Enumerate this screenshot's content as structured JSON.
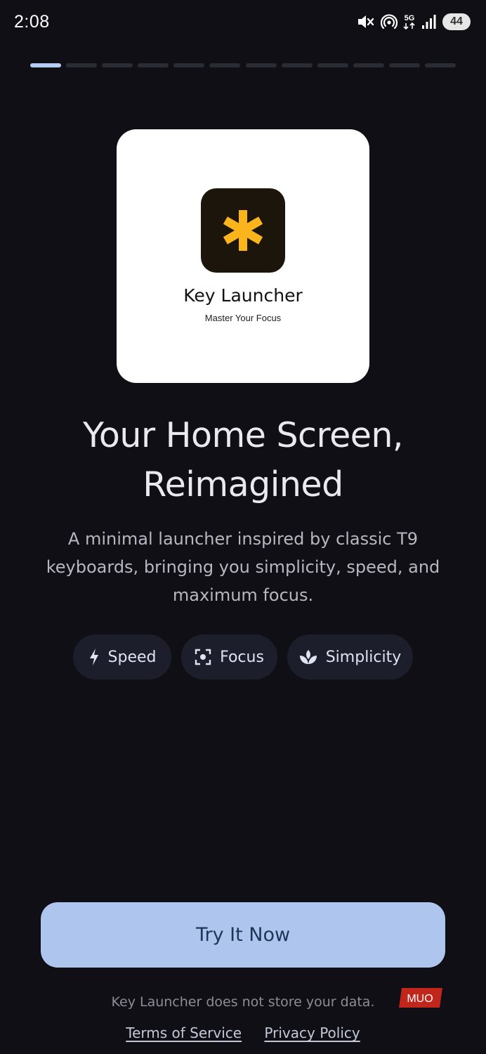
{
  "status_bar": {
    "time": "2:08",
    "network": "5G",
    "battery": "44",
    "icons": [
      "mute-icon",
      "hotspot-icon",
      "network-5g-icon",
      "signal-icon",
      "battery-icon"
    ]
  },
  "onboarding": {
    "total_steps": 12,
    "current_step": 1
  },
  "brand": {
    "name": "Key Launcher",
    "tagline": "Master Your Focus",
    "icon": "asterisk-icon",
    "icon_color": "#f9b51b",
    "icon_bg": "#1c150c"
  },
  "headline": {
    "line1": "Your Home Screen,",
    "line2": "Reimagined"
  },
  "subtitle": "A minimal launcher inspired by classic T9 keyboards, bringing you simplicity, speed, and maximum focus.",
  "chips": [
    {
      "label": "Speed",
      "icon": "lightning-icon"
    },
    {
      "label": "Focus",
      "icon": "focus-target-icon"
    },
    {
      "label": "Simplicity",
      "icon": "spa-icon"
    }
  ],
  "cta": {
    "label": "Try It Now",
    "color": "#aec6ee"
  },
  "footer": {
    "privacy_note": "Key Launcher does not store your data.",
    "terms_label": "Terms of Service",
    "privacy_label": "Privacy Policy"
  },
  "watermark": {
    "text": "MUO",
    "color": "#c0261c"
  },
  "colors": {
    "background": "#100f16",
    "chip_bg": "#1c1f2b",
    "progress_active": "#b3cdf0",
    "progress_inactive": "#2a2b33"
  }
}
